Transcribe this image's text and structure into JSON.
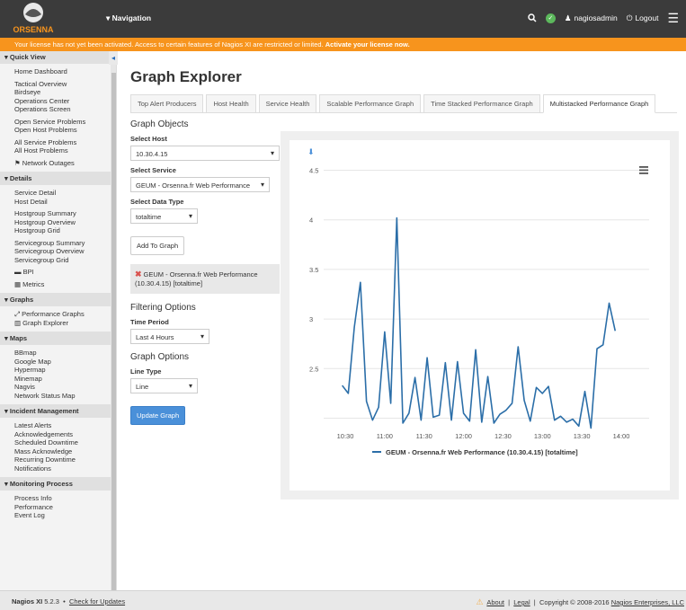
{
  "topbar": {
    "logo_text": "ORSENNA",
    "nav_label": "Navigation",
    "user": "nagiosadmin",
    "logout": "Logout"
  },
  "banner": {
    "text": "Your license has not yet been activated. Access to certain features of Nagios XI are restricted or limited.",
    "link": "Activate your license now."
  },
  "sidebar": {
    "sections": [
      {
        "title": "Quick View",
        "groups": [
          [
            "Home Dashboard"
          ],
          [
            "Tactical Overview",
            "Birdseye",
            "Operations Center",
            "Operations Screen"
          ],
          [
            "Open Service Problems",
            "Open Host Problems"
          ],
          [
            "All Service Problems",
            "All Host Problems"
          ],
          [
            "⚑ Network Outages"
          ]
        ]
      },
      {
        "title": "Details",
        "groups": [
          [
            "Service Detail",
            "Host Detail"
          ],
          [
            "Hostgroup Summary",
            "Hostgroup Overview",
            "Hostgroup Grid"
          ],
          [
            "Servicegroup Summary",
            "Servicegroup Overview",
            "Servicegroup Grid"
          ],
          [
            "▬ BPI"
          ],
          [
            "▦ Metrics"
          ]
        ]
      },
      {
        "title": "Graphs",
        "groups": [
          [
            "⤢ Performance Graphs",
            "▥ Graph Explorer"
          ]
        ]
      },
      {
        "title": "Maps",
        "groups": [
          [
            "BBmap",
            "Google Map",
            "Hypermap",
            "Minemap",
            "Nagvis",
            "Network Status Map"
          ]
        ]
      },
      {
        "title": "Incident Management",
        "groups": [
          [
            "Latest Alerts",
            "Acknowledgements",
            "Scheduled Downtime",
            "Mass Acknowledge",
            "Recurring Downtime",
            "Notifications"
          ]
        ]
      },
      {
        "title": "Monitoring Process",
        "groups": [
          [
            "Process Info",
            "Performance",
            "Event Log"
          ]
        ]
      }
    ]
  },
  "main": {
    "title": "Graph Explorer",
    "tabs": [
      "Top Alert Producers",
      "Host Health",
      "Service Health",
      "Scalable Performance Graph",
      "Time Stacked Performance Graph",
      "Multistacked Performance Graph"
    ],
    "active_tab": 5,
    "graph_objects": "Graph Objects",
    "select_host_label": "Select Host",
    "select_host_value": "10.30.4.15",
    "select_service_label": "Select Service",
    "select_service_value": "GEUM - Orsenna.fr Web Performance",
    "select_type_label": "Select Data Type",
    "select_type_value": "totaltime",
    "add_button": "Add To Graph",
    "graph_item": "GEUM - Orsenna.fr Web Performance (10.30.4.15) [totaltime]",
    "filtering": "Filtering Options",
    "time_period_label": "Time Period",
    "time_period_value": "Last 4 Hours",
    "graph_options": "Graph Options",
    "line_type_label": "Line Type",
    "line_type_value": "Line",
    "update_button": "Update Graph"
  },
  "chart_data": {
    "type": "line",
    "y_ticks": [
      "2.5",
      "3",
      "3.5",
      "4",
      "4.5"
    ],
    "x_ticks": [
      "10:30",
      "11:00",
      "11:30",
      "12:00",
      "12:30",
      "13:00",
      "13:30",
      "14:00"
    ],
    "ylim": [
      1.95,
      4.55
    ],
    "series": [
      {
        "name": "GEUM - Orsenna.fr Web Performance (10.30.4.15) [totaltime]",
        "color": "#2b6ea8",
        "values": [
          2.33,
          2.25,
          2.92,
          3.37,
          2.17,
          1.98,
          2.11,
          2.87,
          2.15,
          4.02,
          1.95,
          2.05,
          2.41,
          1.98,
          2.61,
          2.01,
          2.03,
          2.56,
          1.98,
          2.57,
          2.05,
          1.97,
          2.69,
          1.96,
          2.42,
          1.95,
          2.04,
          2.08,
          2.15,
          2.72,
          2.18,
          1.97,
          2.31,
          2.25,
          2.32,
          1.98,
          2.02,
          1.96,
          1.99,
          1.92,
          2.27,
          1.9,
          2.7,
          2.74,
          3.16,
          2.88
        ]
      }
    ],
    "x_start_label": "10:30",
    "x_start_index": 0.5,
    "x_tick_step": 6.5
  },
  "footer": {
    "product": "Nagios XI",
    "version": "5.2.3",
    "check_updates": "Check for Updates",
    "about": "About",
    "legal": "Legal",
    "copyright": "Copyright © 2008-2016",
    "company": "Nagios Enterprises, LLC"
  }
}
